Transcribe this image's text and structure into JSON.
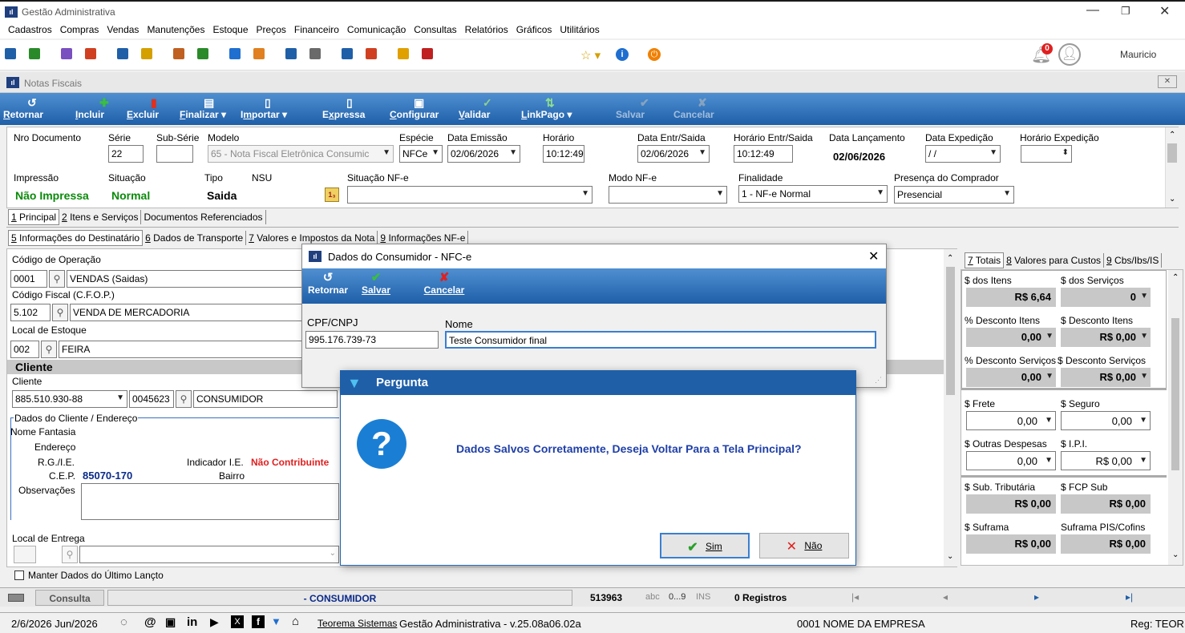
{
  "window": {
    "title": "Gestão Administrativa",
    "user": "Mauricio"
  },
  "menu": [
    "Cadastros",
    "Compras",
    "Vendas",
    "Manutenções",
    "Estoque",
    "Preços",
    "Financeiro",
    "Comunicação",
    "Consultas",
    "Relatórios",
    "Gráficos",
    "Utilitários"
  ],
  "notifications": {
    "count": "0"
  },
  "subwindow": {
    "title": "Notas Fiscais"
  },
  "toolbar": [
    {
      "label": "Retornar",
      "u": "R"
    },
    {
      "label": "Incluir",
      "u": "I"
    },
    {
      "label": "Excluir",
      "u": "E"
    },
    {
      "label": "Finalizar",
      "u": "F"
    },
    {
      "label": "Importar",
      "u": "m"
    },
    {
      "label": "Expressa",
      "u": "x"
    },
    {
      "label": "Configurar",
      "u": "C"
    },
    {
      "label": "Validar",
      "u": "V"
    },
    {
      "label": "LinkPago",
      "u": "L"
    },
    {
      "label": "Salvar",
      "u": ""
    },
    {
      "label": "Cancelar",
      "u": ""
    }
  ],
  "header": {
    "nro_documento_label": "Nro Documento",
    "serie_label": "Série",
    "serie": "22",
    "subserie_label": "Sub-Série",
    "modelo_label": "Modelo",
    "modelo": "65 - Nota Fiscal Eletrônica Consumic",
    "especie_label": "Espécie",
    "especie": "NFCe",
    "data_emissao_label": "Data Emissão",
    "data_emissao": "02/06/2026",
    "horario_label": "Horário",
    "horario": "10:12:49",
    "data_entr_label": "Data Entr/Saida",
    "data_entr": "02/06/2026",
    "horario_entr_label": "Horário Entr/Saida",
    "horario_entr": "10:12:49",
    "data_lanc_label": "Data Lançamento",
    "data_lanc": "02/06/2026",
    "data_exp_label": "Data Expedição",
    "data_exp": " / /",
    "horario_exp_label": "Horário Expedição",
    "impressao_label": "Impressão",
    "impressao": "Não Impressa",
    "situacao_label": "Situação",
    "situacao": "Normal",
    "tipo_label": "Tipo",
    "tipo": "Saida",
    "nsu_label": "NSU",
    "sit_nfe_label": "Situação NF-e",
    "modo_nfe_label": "Modo NF-e",
    "finalidade_label": "Finalidade",
    "finalidade": "1 - NF-e Normal",
    "presenca_label": "Presença do Comprador",
    "presenca": "Presencial"
  },
  "tabs1": [
    {
      "u": "1",
      "label": " Principal"
    },
    {
      "u": "2",
      "label": " Itens e Serviços"
    },
    {
      "u": "",
      "label": "Documentos Referenciados"
    }
  ],
  "tabs2": [
    {
      "u": "5",
      "label": " Informações do Destinatário"
    },
    {
      "u": "6",
      "label": " Dados de Transporte"
    },
    {
      "u": "7",
      "label": " Valores e Impostos da Nota"
    },
    {
      "u": "9",
      "label": " Informações NF-e"
    }
  ],
  "left": {
    "cod_op_label": "Código de Operação",
    "cod_op": "0001",
    "cod_op_desc": "VENDAS (Saidas)",
    "cfop_label": "Código Fiscal (C.F.O.P.)",
    "cfop": "5.102",
    "cfop_desc": "VENDA DE MERCADORIA",
    "local_estoque_label": "Local de Estoque",
    "local_estoque": "002",
    "local_estoque_desc": "FEIRA",
    "cliente_header": "Cliente",
    "cliente_label": "Cliente",
    "cliente_doc": "885.510.930-88",
    "cliente_cod": "0045623",
    "cliente_nome": "CONSUMIDOR",
    "dados_cliente_label": "Dados do Cliente / Endereço",
    "nome_fantasia_label": "Nome Fantasia",
    "endereco_label": "Endereço",
    "rg_label": "R.G./I.E.",
    "indicador_label": "Indicador I.E.",
    "indicador": "Não Contribuinte",
    "cep_label": "C.E.P.",
    "cep": "85070-170",
    "bairro_label": "Bairro",
    "obs_label": "Observações",
    "local_entrega_label": "Local de Entrega",
    "manter_label": "Manter Dados do Último Lançto"
  },
  "right": {
    "tabs": [
      {
        "u": "7",
        "label": " Totais"
      },
      {
        "u": "8",
        "label": " Valores para Custos"
      },
      {
        "u": "9",
        "label": " Cbs/Ibs/IS"
      }
    ],
    "dos_itens_label": "$ dos Itens",
    "dos_itens": "R$ 6,64",
    "dos_servicos_label": "$ dos Serviços",
    "dos_servicos": "0",
    "desc_itens_pct_label": "% Desconto Itens",
    "desc_itens_pct": "0,00",
    "desc_itens_label": "$ Desconto Itens",
    "desc_itens": "R$ 0,00",
    "desc_serv_pct_label": "% Desconto Serviços",
    "desc_serv_pct": "0,00",
    "desc_serv_label": "$ Desconto Serviços",
    "desc_serv": "R$ 0,00",
    "frete_label": "$ Frete",
    "frete": "0,00",
    "seguro_label": "$ Seguro",
    "seguro": "0,00",
    "outras_label": "$ Outras Despesas",
    "outras": "0,00",
    "ipi_label": "$ I.P.I.",
    "ipi": "R$ 0,00",
    "sub_trib_label": "$ Sub. Tributária",
    "sub_trib": "R$ 0,00",
    "fcp_label": "$ FCP Sub",
    "fcp": "R$ 0,00",
    "suframa_label": "$ Suframa",
    "suframa": "R$ 0,00",
    "suframa_pc_label": "Suframa PIS/Cofins",
    "suframa_pc": "R$ 0,00"
  },
  "consumer_dialog": {
    "title": "Dados do Consumidor - NFC-e",
    "retornar": "Retornar",
    "salvar": "Salvar",
    "cancelar": "Cancelar",
    "cpf_label": "CPF/CNPJ",
    "cpf": "995.176.739-73",
    "nome_label": "Nome",
    "nome": "Teste Consumidor final"
  },
  "question_dialog": {
    "title": "Pergunta",
    "message": "Dados Salvos Corretamente, Deseja Voltar Para a Tela Principal?",
    "sim": "Sim",
    "nao": "Não"
  },
  "statusbar1": {
    "consulta": "Consulta",
    "nome": "- CONSUMIDOR",
    "codigo": "513963",
    "abc": "abc",
    "num": "0...9",
    "ins": "INS",
    "registros": "0 Registros"
  },
  "statusbar2": {
    "date": "2/6/2026 Jun/2026",
    "company": "Teorema Sistemas",
    "version": "Gestão Administrativa - v.25.08a06.02a",
    "empresa": "0001 NOME DA EMPRESA",
    "reg": "Reg: TEORE"
  },
  "colors": {
    "accent": "#1f5fa8",
    "green": "#0a8a0a",
    "red": "#e02020",
    "navy": "#0a2a8a"
  }
}
